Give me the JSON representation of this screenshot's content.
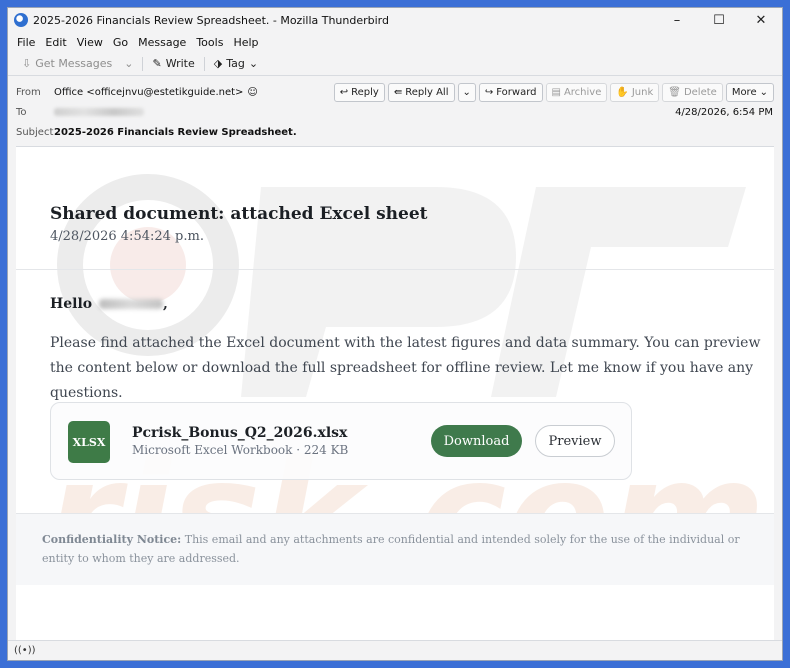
{
  "window": {
    "title": "2025-2026 Financials Review Spreadsheet. - Mozilla Thunderbird",
    "minimize": "–",
    "maximize": "☐",
    "close": "✕"
  },
  "menu": [
    "File",
    "Edit",
    "View",
    "Go",
    "Message",
    "Tools",
    "Help"
  ],
  "toolbar": {
    "get_messages": "Get Messages",
    "write": "Write",
    "tag": "Tag"
  },
  "header": {
    "from_label": "From",
    "from_value": "Office <officejnvu@estetikguide.net>",
    "to_label": "To",
    "subject_label": "Subject",
    "subject_value": "2025-2026 Financials Review Spreadsheet.",
    "date": "4/28/2026, 6:54 PM",
    "actions": {
      "reply": "Reply",
      "reply_all": "Reply All",
      "forward": "Forward",
      "archive": "Archive",
      "junk": "Junk",
      "delete": "Delete",
      "more": "More"
    }
  },
  "message": {
    "title": "Shared document: attached Excel sheet",
    "date": "4/28/2026 4:54:24 p.m.",
    "greeting": "Hello",
    "greeting_suffix": ",",
    "body": "Please find attached the Excel document with the latest figures and data summary. You can preview the content below or download the full spreadsheet for offline review. Let me know if you have any questions.",
    "attachment": {
      "badge": "XLSX",
      "name": "Pcrisk_Bonus_Q2_2026.xlsx",
      "meta": "Microsoft Excel Workbook · 224 KB",
      "download": "Download",
      "preview": "Preview"
    },
    "notice_label": "Confidentiality Notice:",
    "notice_text": " This email and any attachments are confidential and intended solely for the use of the individual or entity to whom they are addressed."
  },
  "colors": {
    "accent_green": "#3f7a4c",
    "xlsx_green": "#3e7b47",
    "desktop_blue": "#3b6fd6"
  }
}
